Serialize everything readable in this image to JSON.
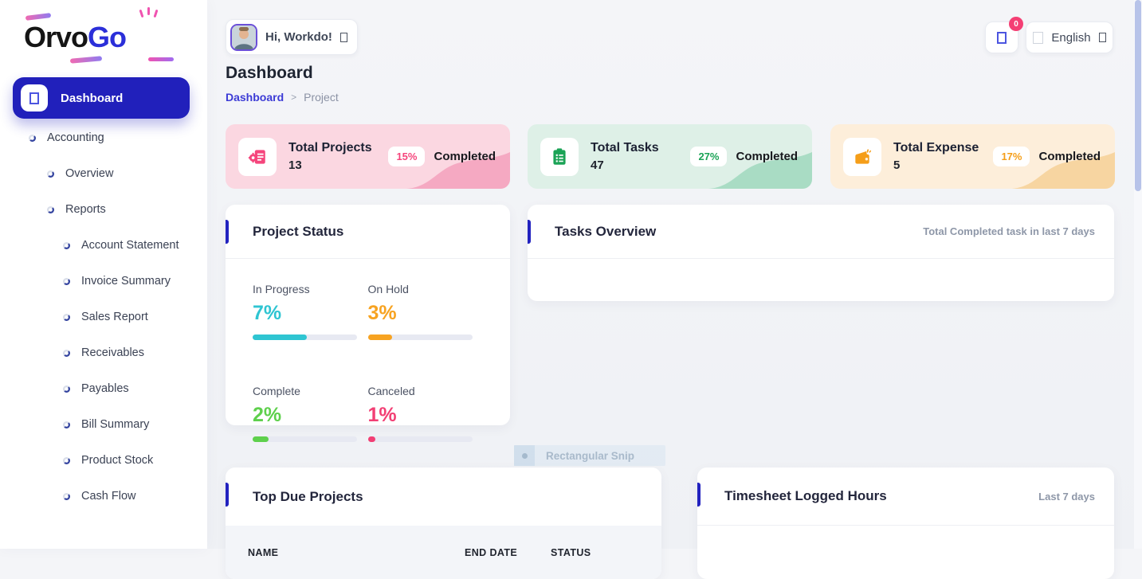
{
  "brand": {
    "part1": "Orvo",
    "part2": "Go"
  },
  "colors": {
    "primary": "#2120bb",
    "accent_bar": "#2222bf",
    "link": "#3c3bd6",
    "scrollbar_thumb": "#b7c3e9"
  },
  "header": {
    "greeting": "Hi, Workdo!",
    "page_title": "Dashboard",
    "breadcrumb_root": "Dashboard",
    "breadcrumb_separator": ">",
    "breadcrumb_current": "Project",
    "notification_count": "0",
    "language_label": "English"
  },
  "icons": {
    "used": [
      "dashboard-icon",
      "bullet-loader-icon",
      "chevron-placeholder-icon",
      "notification-icon",
      "flag-placeholder-icon",
      "projects-icon",
      "tasks-icon",
      "wallet-icon"
    ]
  },
  "sidebar": {
    "items": [
      {
        "label": "Dashboard",
        "level": 0,
        "active": true
      },
      {
        "label": "Accounting",
        "level": 1
      },
      {
        "label": "Overview",
        "level": 2
      },
      {
        "label": "Reports",
        "level": 2
      },
      {
        "label": "Account Statement",
        "level": 3
      },
      {
        "label": "Invoice Summary",
        "level": 3
      },
      {
        "label": "Sales Report",
        "level": 3
      },
      {
        "label": "Receivables",
        "level": 3
      },
      {
        "label": "Payables",
        "level": 3
      },
      {
        "label": "Bill Summary",
        "level": 3
      },
      {
        "label": "Product Stock",
        "level": 3
      },
      {
        "label": "Cash Flow",
        "level": 3
      }
    ]
  },
  "stat_cards": [
    {
      "title": "Total Projects",
      "value": "13",
      "percent": "15%",
      "completed_label": "Completed",
      "bg": "#fbd7e1",
      "wave": "#f5a9c2",
      "accent": "#f5457c"
    },
    {
      "title": "Total Tasks",
      "value": "47",
      "percent": "27%",
      "completed_label": "Completed",
      "bg": "#def0e7",
      "wave": "#a9dcc4",
      "accent": "#1ba356"
    },
    {
      "title": "Total Expense",
      "value": "5",
      "percent": "17%",
      "completed_label": "Completed",
      "bg": "#fdeeda",
      "wave": "#f7d5a1",
      "accent": "#f59e19"
    }
  ],
  "project_status": {
    "title": "Project Status",
    "items": [
      {
        "label": "In Progress",
        "percent": "7%",
        "color": "#2fc5d2",
        "bar_fill_pct": 52
      },
      {
        "label": "On Hold",
        "percent": "3%",
        "color": "#f7a321",
        "bar_fill_pct": 23
      },
      {
        "label": "Complete",
        "percent": "2%",
        "color": "#5ed04c",
        "bar_fill_pct": 15
      },
      {
        "label": "Canceled",
        "percent": "1%",
        "color": "#f23f74",
        "bar_fill_pct": 7
      }
    ]
  },
  "tasks_overview": {
    "title": "Tasks Overview",
    "subtitle": "Total Completed task in last 7 days"
  },
  "top_due_projects": {
    "title": "Top Due Projects",
    "columns": [
      "NAME",
      "END DATE",
      "STATUS"
    ]
  },
  "timesheet": {
    "title": "Timesheet Logged Hours",
    "subtitle": "Last 7 days"
  },
  "overlay": {
    "snip_label": "Rectangular Snip"
  }
}
